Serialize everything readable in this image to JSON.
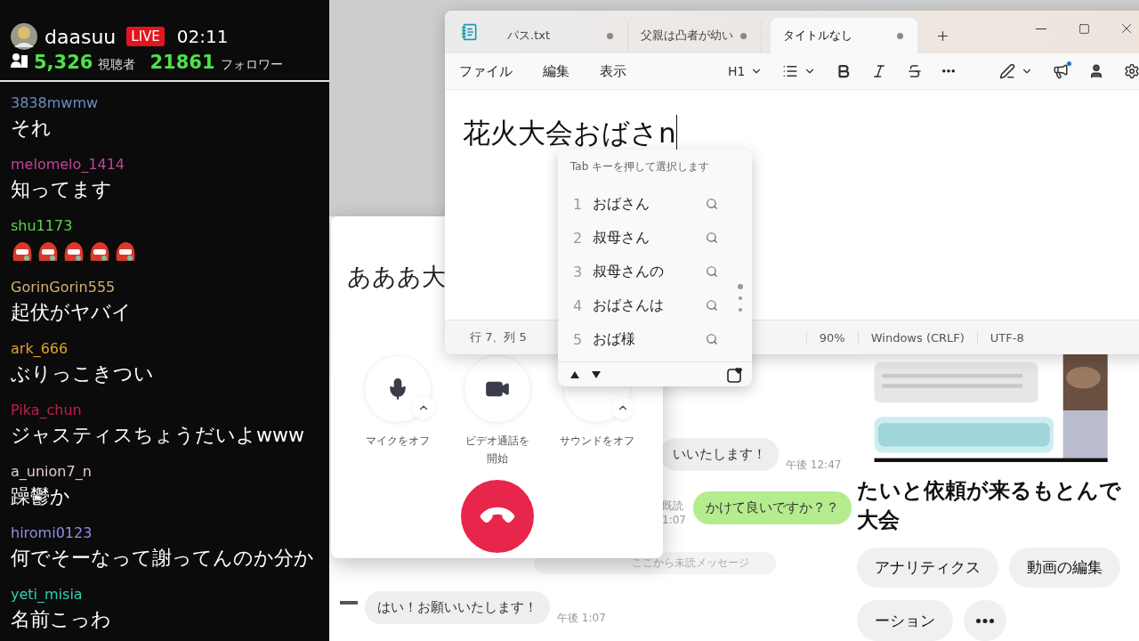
{
  "stream_chat": {
    "streamer": "daasuu",
    "live_badge": "LIVE",
    "elapsed": "02:11",
    "viewers": "5,326",
    "viewers_label": "視聴者",
    "followers": "21861",
    "followers_label": "フォロワー",
    "messages": [
      {
        "user": "3838mwmw",
        "color": "#6b8cc4",
        "kind": "text",
        "text": "それ"
      },
      {
        "user": "melomelo_1414",
        "color": "#c2449a",
        "kind": "text",
        "text": "知ってます"
      },
      {
        "user": "shu1173",
        "color": "#5fd34d",
        "kind": "emotes"
      },
      {
        "user": "GorinGorin555",
        "color": "#d6b074",
        "kind": "text",
        "text": "起伏がヤバイ"
      },
      {
        "user": "ark_666",
        "color": "#e0a030",
        "kind": "text",
        "text": "ぶりっこきつい"
      },
      {
        "user": "Pika_chun",
        "color": "#c0204a",
        "kind": "text",
        "text": "ジャスティスちょうだいよwww"
      },
      {
        "user": "a_union7_n",
        "color": "#e2c8d2",
        "kind": "text",
        "text": "躁鬱か"
      },
      {
        "user": "hiromi0123",
        "color": "#9090e0",
        "kind": "text",
        "text": "何でそーなって謝ってんのか分か"
      },
      {
        "user": "yeti_misia",
        "color": "#30d0b0",
        "kind": "text",
        "text": "名前こっわ"
      }
    ]
  },
  "line_chat": {
    "messages": [
      {
        "kind": "incoming",
        "avatar": false,
        "text": "いいたします！",
        "time": "午後 12:47"
      },
      {
        "kind": "outgoing",
        "text": "かけて良いですか？？",
        "read": "既読",
        "time": "1:07"
      },
      {
        "kind": "divider",
        "text": "ここから未読メッセージ"
      },
      {
        "kind": "incoming",
        "avatar": true,
        "text": "はい！お願いいたします！",
        "time": "午後 1:07"
      }
    ]
  },
  "video_page": {
    "title": "たいと依頼が来るもとんで大会",
    "chips": [
      "アナリティクス",
      "動画の編集",
      "ーション"
    ]
  },
  "call_window": {
    "name": "あああ大",
    "controls": [
      {
        "kind": "mic",
        "label": "マイクをオフ"
      },
      {
        "kind": "video",
        "label": "ビデオ通話を開始"
      },
      {
        "kind": "sound",
        "label": "サウンドをオフ"
      }
    ]
  },
  "notepad": {
    "tabs": [
      {
        "label": "パス.txt",
        "selected": false
      },
      {
        "label": "父親は凸者が幼い",
        "selected": false
      },
      {
        "label": "タイトルなし",
        "selected": true
      }
    ],
    "menu": [
      "ファイル",
      "編集",
      "表示"
    ],
    "heading": "H1",
    "editor": {
      "text": "花火大会",
      "composition": "おばさn"
    },
    "status": [
      "行 7、列 5",
      "90%",
      "Windows (CRLF)",
      "UTF-8"
    ]
  },
  "ime_popup": {
    "hint": "Tab キーを押して選択します",
    "candidates": [
      {
        "number": "1",
        "text": "おばさん"
      },
      {
        "number": "2",
        "text": "叔母さん"
      },
      {
        "number": "3",
        "text": "叔母さんの"
      },
      {
        "number": "4",
        "text": "おばさんは"
      },
      {
        "number": "5",
        "text": "おば様"
      }
    ]
  }
}
